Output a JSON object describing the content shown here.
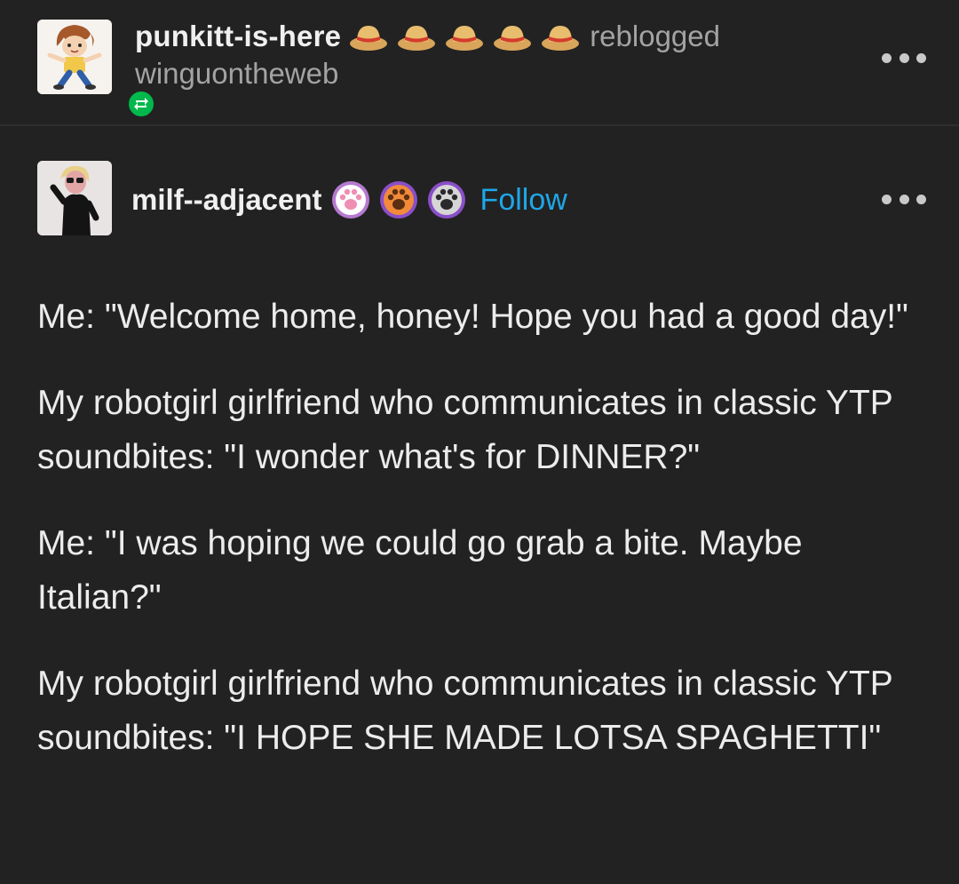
{
  "reblog": {
    "reblogger": "punkitt-is-here",
    "badge_icons": [
      "straw-hat-icon",
      "straw-hat-icon",
      "straw-hat-icon",
      "straw-hat-icon",
      "straw-hat-icon"
    ],
    "action": "reblogged",
    "source": "winguontheweb",
    "reblog_icon": "reblog-icon",
    "more_icon": "more-options-icon"
  },
  "post": {
    "author": "milf--adjacent",
    "badge_icons": [
      "paw-badge-pink-icon",
      "paw-badge-orange-icon",
      "paw-badge-gray-icon"
    ],
    "follow_label": "Follow",
    "more_icon": "more-options-icon",
    "paragraphs": [
      "Me: \"Welcome home, honey! Hope you had a good day!\"",
      "My robotgirl girlfriend who communicates in classic YTP soundbites: \"I wonder what's for DINNER?\"",
      "Me: \"I was hoping we could go grab a bite. Maybe Italian?\"",
      "My robotgirl girlfriend who communicates in classic YTP soundbites: \"I HOPE SHE MADE LOTSA SPAGHETTI\""
    ]
  },
  "colors": {
    "background": "#222222",
    "text": "#ececec",
    "muted_text": "#a3a3a3",
    "follow_link": "#1ea7e8",
    "reblog_badge": "#00b84b"
  }
}
